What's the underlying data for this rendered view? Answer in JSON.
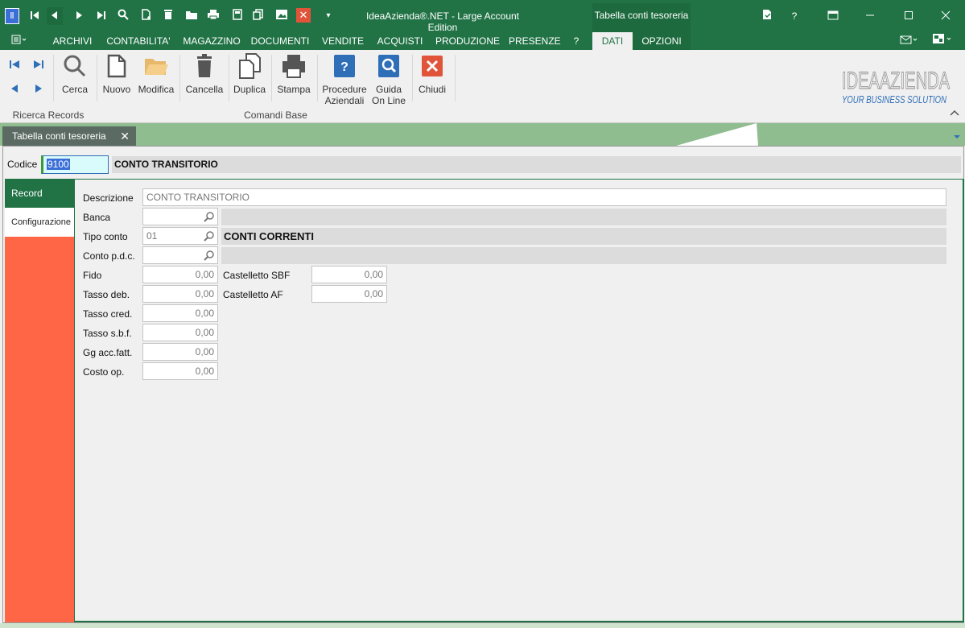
{
  "titlebar": {
    "app_title": "IdeaAzienda®.NET - Large Account Edition",
    "context_title": "Tabella conti tesoreria",
    "app_icon": "app-logo-icon",
    "quick_access": [
      "first-record-icon",
      "previous-record-icon",
      "next-record-icon",
      "last-record-icon",
      "search-icon",
      "new-doc-icon",
      "delete-icon",
      "folder-icon",
      "print-icon",
      "calculator-icon",
      "copy-icon",
      "image-icon",
      "close-red-icon",
      "dropdown-arrow-icon"
    ],
    "dropdown_glyph": "▾",
    "window_controls": {
      "help": "?"
    }
  },
  "menu": {
    "items": [
      "ARCHIVI",
      "CONTABILITA'",
      "MAGAZZINO",
      "DOCUMENTI",
      "VENDITE",
      "ACQUISTI",
      "PRODUZIONE",
      "PRESENZE",
      "?",
      "DATI",
      "OPZIONI"
    ]
  },
  "ribbon": {
    "buttons": {
      "cerca": "Cerca",
      "nuovo": "Nuovo",
      "modifica": "Modifica",
      "cancella": "Cancella",
      "duplica": "Duplica",
      "stampa": "Stampa",
      "procedure_1": "Procedure",
      "procedure_2": "Aziendali",
      "guida_1": "Guida",
      "guida_2": "On Line",
      "chiudi": "Chiudi"
    },
    "groups": {
      "ricerca": "Ricerca Records",
      "comandi": "Comandi Base"
    },
    "logo_text_1": "IDEAAZIENDA",
    "logo_text_2": "YOUR BUSINESS SOLUTION"
  },
  "doc_tab": {
    "label": "Tabella conti tesoreria",
    "close": "✕"
  },
  "form": {
    "codice_label": "Codice",
    "codice_value": "9100",
    "codice_desc": "CONTO TRANSITORIO",
    "side_tabs": [
      "Record",
      "Configurazione"
    ],
    "fields": {
      "descrizione_label": "Descrizione",
      "descrizione_value": "CONTO TRANSITORIO",
      "banca_label": "Banca",
      "banca_value": "",
      "banca_desc": "",
      "tipo_label": "Tipo conto",
      "tipo_value": "01",
      "tipo_desc": "CONTI CORRENTI",
      "pdc_label": "Conto p.d.c.",
      "pdc_value": "",
      "pdc_desc": "",
      "fido_label": "Fido",
      "fido_value": "0,00",
      "tdeb_label": "Tasso deb.",
      "tdeb_value": "0,00",
      "tcred_label": "Tasso cred.",
      "tcred_value": "0,00",
      "tsbf_label": "Tasso s.b.f.",
      "tsbf_value": "0,00",
      "gg_label": "Gg acc.fatt.",
      "gg_value": "0,00",
      "costo_label": "Costo op.",
      "costo_value": "0,00",
      "cast_sbf_label": "Castelletto SBF",
      "cast_sbf_value": "0,00",
      "cast_af_label": "Castelletto AF",
      "cast_af_value": "0,00"
    }
  },
  "colors": {
    "brand": "#217346",
    "side": "#ff6645",
    "tabstrip": "#8fbd8f"
  }
}
